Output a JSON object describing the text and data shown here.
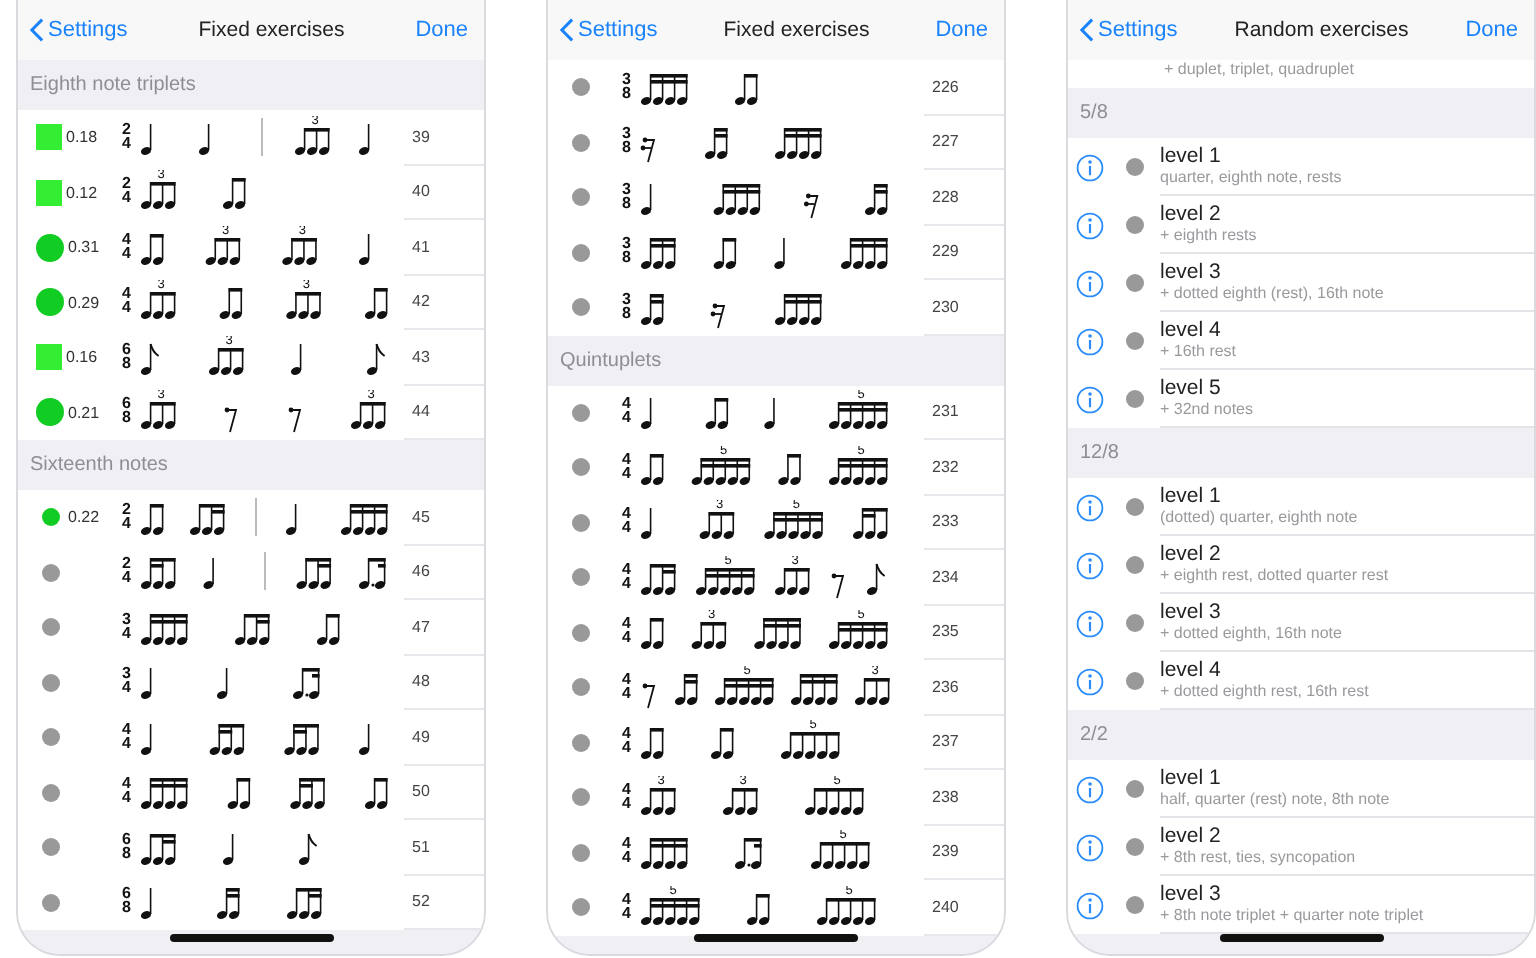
{
  "screens": [
    {
      "nav": {
        "back": "Settings",
        "title": "Fixed exercises",
        "done": "Done"
      },
      "sections": [
        {
          "header": "Eighth note triplets",
          "rows": [
            {
              "kind": "exercise",
              "status": {
                "kind": "square",
                "color": "#33ee33",
                "score": "0.18"
              },
              "time_signature": [
                "2",
                "4"
              ],
              "notation": [
                {
                  "kind": "q"
                },
                {
                  "kind": "q"
                },
                {
                  "kind": "bar"
                },
                {
                  "kind": "b3",
                  "tuplet": "3"
                },
                {
                  "kind": "q"
                }
              ],
              "number": "39"
            },
            {
              "kind": "exercise",
              "status": {
                "kind": "square",
                "color": "#33ee33",
                "score": "0.12"
              },
              "time_signature": [
                "2",
                "4"
              ],
              "notation": [
                {
                  "kind": "b3",
                  "tuplet": "3"
                },
                {
                  "kind": "b2"
                }
              ],
              "number": "40"
            },
            {
              "kind": "exercise",
              "status": {
                "kind": "circle",
                "color": "#11cc22",
                "score": "0.31"
              },
              "time_signature": [
                "4",
                "4"
              ],
              "notation": [
                {
                  "kind": "b2"
                },
                {
                  "kind": "b3",
                  "tuplet": "3"
                },
                {
                  "kind": "b3",
                  "tuplet": "3"
                },
                {
                  "kind": "q"
                }
              ],
              "number": "41"
            },
            {
              "kind": "exercise",
              "status": {
                "kind": "circle",
                "color": "#11cc22",
                "score": "0.29"
              },
              "time_signature": [
                "4",
                "4"
              ],
              "notation": [
                {
                  "kind": "b3",
                  "tuplet": "3"
                },
                {
                  "kind": "b2"
                },
                {
                  "kind": "b3",
                  "tuplet": "3"
                },
                {
                  "kind": "b2"
                }
              ],
              "number": "42"
            },
            {
              "kind": "exercise",
              "status": {
                "kind": "square",
                "color": "#33ee33",
                "score": "0.16"
              },
              "time_signature": [
                "6",
                "8"
              ],
              "notation": [
                {
                  "kind": "e"
                },
                {
                  "kind": "b3",
                  "tuplet": "3"
                },
                {
                  "kind": "q"
                },
                {
                  "kind": "e"
                }
              ],
              "number": "43"
            },
            {
              "kind": "exercise",
              "status": {
                "kind": "circle",
                "color": "#11cc22",
                "score": "0.21"
              },
              "time_signature": [
                "6",
                "8"
              ],
              "notation": [
                {
                  "kind": "b3",
                  "tuplet": "3"
                },
                {
                  "kind": "r8"
                },
                {
                  "kind": "r8"
                },
                {
                  "kind": "b3",
                  "tuplet": "3"
                }
              ],
              "number": "44"
            }
          ]
        },
        {
          "header": "Sixteenth notes",
          "rows": [
            {
              "kind": "exercise",
              "status": {
                "kind": "dot",
                "color": "#11cc22",
                "score": "0.22"
              },
              "time_signature": [
                "2",
                "4"
              ],
              "notation": [
                {
                  "kind": "b2"
                },
                {
                  "kind": "m3"
                },
                {
                  "kind": "bar"
                },
                {
                  "kind": "q"
                },
                {
                  "kind": "s4"
                }
              ],
              "number": "45"
            },
            {
              "kind": "exercise",
              "status": {
                "kind": "dot",
                "color": "#999999"
              },
              "time_signature": [
                "2",
                "4"
              ],
              "notation": [
                {
                  "kind": "m3r"
                },
                {
                  "kind": "q"
                },
                {
                  "kind": "bar"
                },
                {
                  "kind": "m3"
                },
                {
                  "kind": "d2"
                }
              ],
              "number": "46"
            },
            {
              "kind": "exercise",
              "status": {
                "kind": "dot",
                "color": "#999999"
              },
              "time_signature": [
                "3",
                "4"
              ],
              "notation": [
                {
                  "kind": "s4"
                },
                {
                  "kind": "m3"
                },
                {
                  "kind": "b2"
                }
              ],
              "number": "47"
            },
            {
              "kind": "exercise",
              "status": {
                "kind": "dot",
                "color": "#999999"
              },
              "time_signature": [
                "3",
                "4"
              ],
              "notation": [
                {
                  "kind": "q"
                },
                {
                  "kind": "q"
                },
                {
                  "kind": "d2"
                }
              ],
              "number": "48"
            },
            {
              "kind": "exercise",
              "status": {
                "kind": "dot",
                "color": "#999999"
              },
              "time_signature": [
                "4",
                "4"
              ],
              "notation": [
                {
                  "kind": "q"
                },
                {
                  "kind": "m3r"
                },
                {
                  "kind": "m3r"
                },
                {
                  "kind": "q"
                }
              ],
              "number": "49"
            },
            {
              "kind": "exercise",
              "status": {
                "kind": "dot",
                "color": "#999999"
              },
              "time_signature": [
                "4",
                "4"
              ],
              "notation": [
                {
                  "kind": "s4"
                },
                {
                  "kind": "b2"
                },
                {
                  "kind": "m3r"
                },
                {
                  "kind": "b2"
                }
              ],
              "number": "50"
            },
            {
              "kind": "exercise",
              "status": {
                "kind": "dot",
                "color": "#999999"
              },
              "time_signature": [
                "6",
                "8"
              ],
              "notation": [
                {
                  "kind": "m3"
                },
                {
                  "kind": "q"
                },
                {
                  "kind": "e"
                }
              ],
              "number": "51"
            },
            {
              "kind": "exercise",
              "status": {
                "kind": "dot",
                "color": "#999999"
              },
              "time_signature": [
                "6",
                "8"
              ],
              "notation": [
                {
                  "kind": "q"
                },
                {
                  "kind": "s2"
                },
                {
                  "kind": "m3"
                }
              ],
              "number": "52"
            }
          ]
        }
      ]
    },
    {
      "nav": {
        "back": "Settings",
        "title": "Fixed exercises",
        "done": "Done"
      },
      "sections": [
        {
          "rows": [
            {
              "kind": "exercise",
              "status": {
                "kind": "dot",
                "color": "#999999"
              },
              "time_signature": [
                "3",
                "8"
              ],
              "notation": [
                {
                  "kind": "s4"
                },
                {
                  "kind": "b2"
                }
              ],
              "number": "226"
            },
            {
              "kind": "exercise",
              "status": {
                "kind": "dot",
                "color": "#999999"
              },
              "time_signature": [
                "3",
                "8"
              ],
              "notation": [
                {
                  "kind": "r16"
                },
                {
                  "kind": "s2"
                },
                {
                  "kind": "s4"
                }
              ],
              "number": "227"
            },
            {
              "kind": "exercise",
              "status": {
                "kind": "dot",
                "color": "#999999"
              },
              "time_signature": [
                "3",
                "8"
              ],
              "notation": [
                {
                  "kind": "q"
                },
                {
                  "kind": "s4"
                },
                {
                  "kind": "r16"
                },
                {
                  "kind": "s2"
                }
              ],
              "number": "228"
            },
            {
              "kind": "exercise",
              "status": {
                "kind": "dot",
                "color": "#999999"
              },
              "time_signature": [
                "3",
                "8"
              ],
              "notation": [
                {
                  "kind": "s3"
                },
                {
                  "kind": "b2"
                },
                {
                  "kind": "q"
                },
                {
                  "kind": "s4"
                }
              ],
              "number": "229"
            },
            {
              "kind": "exercise",
              "status": {
                "kind": "dot",
                "color": "#999999"
              },
              "time_signature": [
                "3",
                "8"
              ],
              "notation": [
                {
                  "kind": "s2"
                },
                {
                  "kind": "r16"
                },
                {
                  "kind": "s4"
                }
              ],
              "number": "230"
            }
          ]
        },
        {
          "header": "Quintuplets",
          "rows": [
            {
              "kind": "exercise",
              "status": {
                "kind": "dot",
                "color": "#999999"
              },
              "time_signature": [
                "4",
                "4"
              ],
              "notation": [
                {
                  "kind": "q"
                },
                {
                  "kind": "b2"
                },
                {
                  "kind": "q"
                },
                {
                  "kind": "s5",
                  "tuplet": "5"
                }
              ],
              "number": "231"
            },
            {
              "kind": "exercise",
              "status": {
                "kind": "dot",
                "color": "#999999"
              },
              "time_signature": [
                "4",
                "4"
              ],
              "notation": [
                {
                  "kind": "b2"
                },
                {
                  "kind": "s5",
                  "tuplet": "5"
                },
                {
                  "kind": "b2"
                },
                {
                  "kind": "s5",
                  "tuplet": "5"
                }
              ],
              "number": "232"
            },
            {
              "kind": "exercise",
              "status": {
                "kind": "dot",
                "color": "#999999"
              },
              "time_signature": [
                "4",
                "4"
              ],
              "notation": [
                {
                  "kind": "q"
                },
                {
                  "kind": "b3",
                  "tuplet": "3"
                },
                {
                  "kind": "s5",
                  "tuplet": "5"
                },
                {
                  "kind": "m3r"
                }
              ],
              "number": "233"
            },
            {
              "kind": "exercise",
              "status": {
                "kind": "dot",
                "color": "#999999"
              },
              "time_signature": [
                "4",
                "4"
              ],
              "notation": [
                {
                  "kind": "m3"
                },
                {
                  "kind": "s5",
                  "tuplet": "5"
                },
                {
                  "kind": "b3",
                  "tuplet": "3"
                },
                {
                  "kind": "r8"
                },
                {
                  "kind": "e"
                }
              ],
              "number": "234"
            },
            {
              "kind": "exercise",
              "status": {
                "kind": "dot",
                "color": "#999999"
              },
              "time_signature": [
                "4",
                "4"
              ],
              "notation": [
                {
                  "kind": "b2"
                },
                {
                  "kind": "b3",
                  "tuplet": "3"
                },
                {
                  "kind": "s4"
                },
                {
                  "kind": "s5",
                  "tuplet": "5"
                }
              ],
              "number": "235"
            },
            {
              "kind": "exercise",
              "status": {
                "kind": "dot",
                "color": "#999999"
              },
              "time_signature": [
                "4",
                "4"
              ],
              "notation": [
                {
                  "kind": "r8"
                },
                {
                  "kind": "s2"
                },
                {
                  "kind": "s5",
                  "tuplet": "5"
                },
                {
                  "kind": "s4"
                },
                {
                  "kind": "b3",
                  "tuplet": "3"
                }
              ],
              "number": "236"
            },
            {
              "kind": "exercise",
              "status": {
                "kind": "dot",
                "color": "#999999"
              },
              "time_signature": [
                "4",
                "4"
              ],
              "notation": [
                {
                  "kind": "b2"
                },
                {
                  "kind": "b2"
                },
                {
                  "kind": "b5",
                  "tuplet": "5"
                }
              ],
              "number": "237"
            },
            {
              "kind": "exercise",
              "status": {
                "kind": "dot",
                "color": "#999999"
              },
              "time_signature": [
                "4",
                "4"
              ],
              "notation": [
                {
                  "kind": "b3",
                  "tuplet": "3"
                },
                {
                  "kind": "b3",
                  "tuplet": "3"
                },
                {
                  "kind": "b5",
                  "tuplet": "5"
                }
              ],
              "number": "238"
            },
            {
              "kind": "exercise",
              "status": {
                "kind": "dot",
                "color": "#999999"
              },
              "time_signature": [
                "4",
                "4"
              ],
              "notation": [
                {
                  "kind": "s4"
                },
                {
                  "kind": "d2"
                },
                {
                  "kind": "b5",
                  "tuplet": "5"
                }
              ],
              "number": "239"
            },
            {
              "kind": "exercise",
              "status": {
                "kind": "dot",
                "color": "#999999"
              },
              "time_signature": [
                "4",
                "4"
              ],
              "notation": [
                {
                  "kind": "s5",
                  "tuplet": "5"
                },
                {
                  "kind": "b2"
                },
                {
                  "kind": "b5",
                  "tuplet": "5"
                }
              ],
              "number": "240"
            }
          ]
        }
      ]
    },
    {
      "nav": {
        "back": "Settings",
        "title": "Random exercises",
        "done": "Done"
      },
      "sections": [
        {
          "rows": [
            {
              "kind": "partial",
              "subtitle": "+ duplet, triplet, quadruplet"
            }
          ]
        },
        {
          "header": "5/8",
          "rows": [
            {
              "kind": "level",
              "color": "#999999",
              "title": "level 1",
              "subtitle": "quarter, eighth note, rests"
            },
            {
              "kind": "level",
              "color": "#999999",
              "title": "level 2",
              "subtitle": "+ eighth rests"
            },
            {
              "kind": "level",
              "color": "#999999",
              "title": "level 3",
              "subtitle": "+ dotted eighth (rest), 16th note"
            },
            {
              "kind": "level",
              "color": "#999999",
              "title": "level 4",
              "subtitle": "+ 16th rest"
            },
            {
              "kind": "level",
              "color": "#999999",
              "title": "level 5",
              "subtitle": "+ 32nd notes"
            }
          ]
        },
        {
          "header": "12/8",
          "rows": [
            {
              "kind": "level",
              "color": "#999999",
              "title": "level 1",
              "subtitle": "(dotted) quarter, eighth note"
            },
            {
              "kind": "level",
              "color": "#999999",
              "title": "level 2",
              "subtitle": "+ eighth rest, dotted quarter rest"
            },
            {
              "kind": "level",
              "color": "#999999",
              "title": "level 3",
              "subtitle": "+ dotted eighth, 16th note"
            },
            {
              "kind": "level",
              "color": "#999999",
              "title": "level 4",
              "subtitle": "+ dotted eighth rest, 16th rest"
            }
          ]
        },
        {
          "header": "2/2",
          "rows": [
            {
              "kind": "level",
              "color": "#999999",
              "title": "level 1",
              "subtitle": "half, quarter (rest) note, 8th note"
            },
            {
              "kind": "level",
              "color": "#999999",
              "title": "level 2",
              "subtitle": "+ 8th rest, ties, syncopation"
            },
            {
              "kind": "level",
              "color": "#999999",
              "title": "level 3",
              "subtitle": "+ 8th note triplet + quarter note triplet"
            }
          ]
        }
      ]
    }
  ]
}
